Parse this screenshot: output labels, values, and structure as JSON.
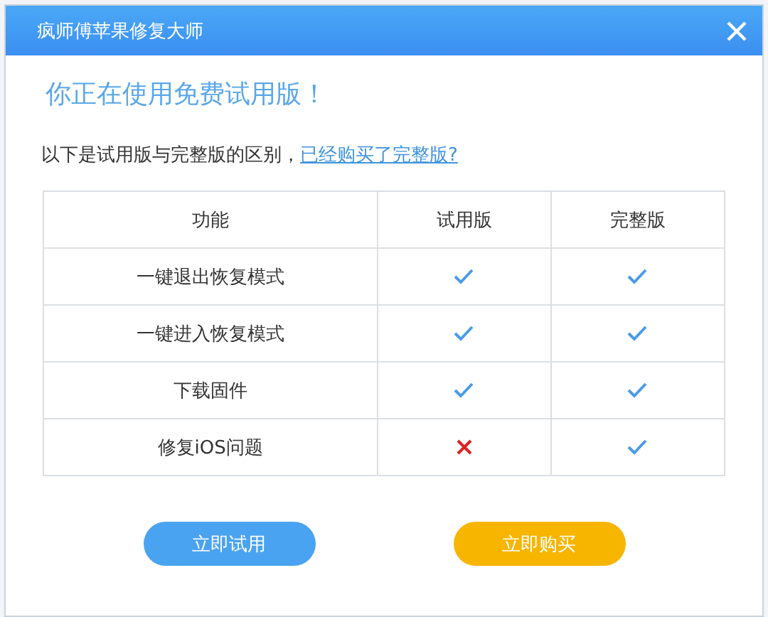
{
  "window": {
    "title": "疯师傅苹果修复大师"
  },
  "heading": "你正在使用免费试用版！",
  "intro": {
    "text": "以下是试用版与完整版的区别，",
    "link": "已经购买了完整版?"
  },
  "table": {
    "columns": [
      "功能",
      "试用版",
      "完整版"
    ],
    "rows": [
      {
        "feature": "一键退出恢复模式",
        "trial": true,
        "full": true
      },
      {
        "feature": "一键进入恢复模式",
        "trial": true,
        "full": true
      },
      {
        "feature": "下载固件",
        "trial": true,
        "full": true
      },
      {
        "feature": "修复iOS问题",
        "trial": false,
        "full": true
      }
    ]
  },
  "buttons": [
    {
      "label": "立即试用",
      "kind": "trial"
    },
    {
      "label": "立即购买",
      "kind": "buy"
    }
  ]
}
